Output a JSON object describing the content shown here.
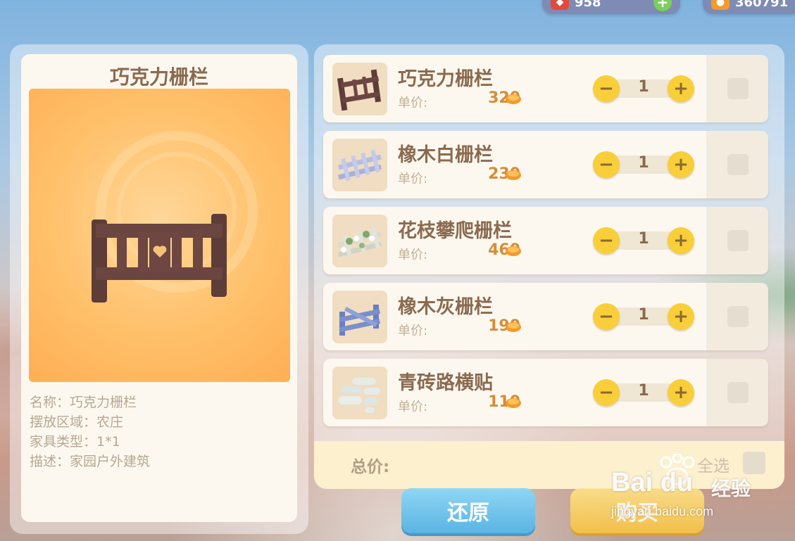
{
  "currency": {
    "gems": "958",
    "coins": "360791"
  },
  "detail": {
    "title": "巧克力栅栏",
    "name_line": "名称：巧克力栅栏",
    "area_line": "摆放区域：农庄",
    "type_line": "家具类型：1*1",
    "desc_line": "描述：家园户外建筑"
  },
  "items": [
    {
      "name": "巧克力栅栏",
      "price_label": "单价:",
      "price": "320",
      "qty": "1",
      "icon": "chocolate-fence"
    },
    {
      "name": "橡木白栅栏",
      "price_label": "单价:",
      "price": "230",
      "qty": "1",
      "icon": "white-oak-fence"
    },
    {
      "name": "花枝攀爬栅栏",
      "price_label": "单价:",
      "price": "460",
      "qty": "1",
      "icon": "flower-vine-fence"
    },
    {
      "name": "橡木灰栅栏",
      "price_label": "单价:",
      "price": "190",
      "qty": "1",
      "icon": "gray-oak-fence"
    },
    {
      "name": "青砖路横贴",
      "price_label": "单价:",
      "price": "110",
      "qty": "1",
      "icon": "brick-path"
    }
  ],
  "stepper": {
    "minus": "−",
    "plus": "+"
  },
  "footer": {
    "total_label": "总价:",
    "select_all_label": "全选"
  },
  "buttons": {
    "reset": "还原",
    "buy": "购买"
  },
  "watermark": {
    "logo": "Bai  du",
    "cn": "经验",
    "url": "jingyan.baidu.com"
  },
  "colors": {
    "panel": "#fdf8ef",
    "title_brown": "#8a6a4f",
    "price_orange": "#d58d3a",
    "stepper_yellow": "#f8cf3a",
    "reset_blue": "#5ab4e2",
    "buy_yellow": "#f8c341"
  }
}
